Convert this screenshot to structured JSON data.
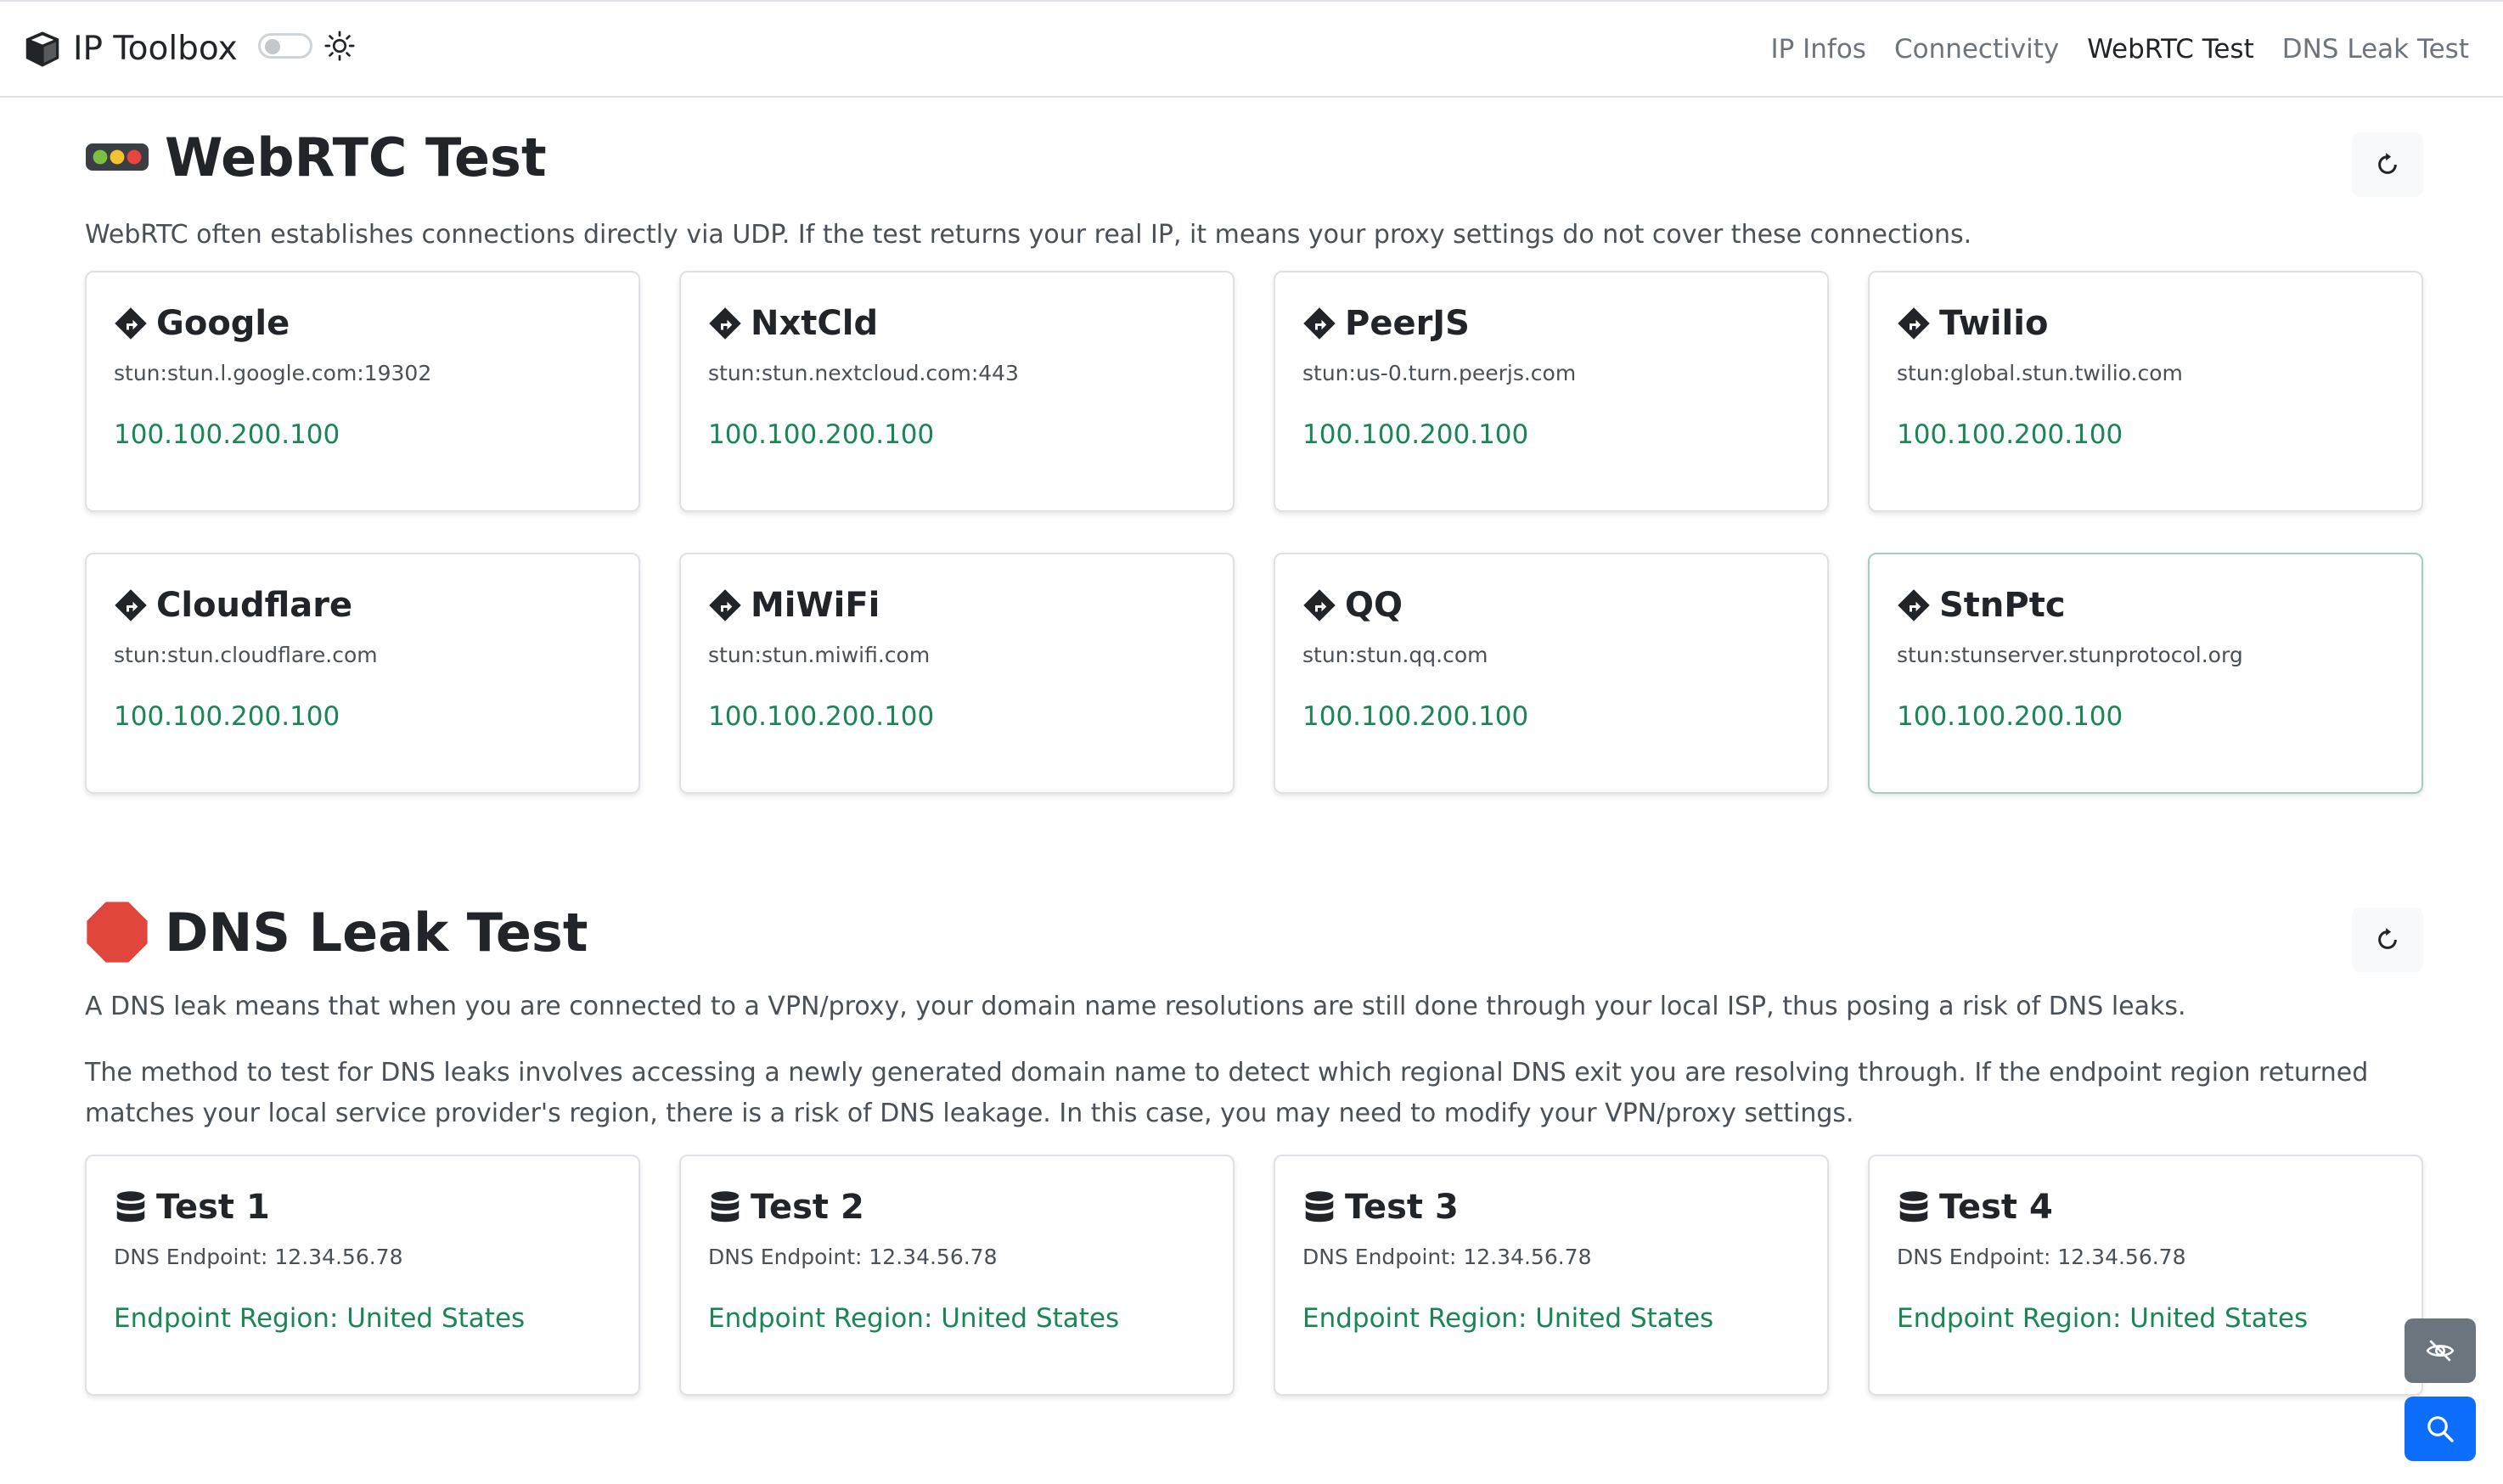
{
  "app": {
    "title": "IP Toolbox",
    "nav": [
      "IP Infos",
      "Connectivity",
      "WebRTC Test",
      "DNS Leak Test"
    ],
    "active_nav": "WebRTC Test"
  },
  "webrtc": {
    "title": "WebRTC Test",
    "description": "WebRTC often establishes connections directly via UDP. If the test returns your real IP, it means your proxy settings do not cover these connections.",
    "servers": [
      {
        "name": "Google",
        "url": "stun:stun.l.google.com:19302",
        "ip": "100.100.200.100"
      },
      {
        "name": "NxtCld",
        "url": "stun:stun.nextcloud.com:443",
        "ip": "100.100.200.100"
      },
      {
        "name": "PeerJS",
        "url": "stun:us-0.turn.peerjs.com",
        "ip": "100.100.200.100"
      },
      {
        "name": "Twilio",
        "url": "stun:global.stun.twilio.com",
        "ip": "100.100.200.100"
      },
      {
        "name": "Cloudflare",
        "url": "stun:stun.cloudflare.com",
        "ip": "100.100.200.100"
      },
      {
        "name": "MiWiFi",
        "url": "stun:stun.miwifi.com",
        "ip": "100.100.200.100"
      },
      {
        "name": "QQ",
        "url": "stun:stun.qq.com",
        "ip": "100.100.200.100"
      },
      {
        "name": "StnPtc",
        "url": "stun:stunserver.stunprotocol.org",
        "ip": "100.100.200.100"
      }
    ]
  },
  "dns": {
    "title": "DNS Leak Test",
    "description1": "A DNS leak means that when you are connected to a VPN/proxy, your domain name resolutions are still done through your local ISP, thus posing a risk of DNS leaks.",
    "description2": "The method to test for DNS leaks involves accessing a newly generated domain name to detect which regional DNS exit you are resolving through. If the endpoint region returned matches your local service provider's region, there is a risk of DNS leakage. In this case, you may need to modify your VPN/proxy settings.",
    "tests": [
      {
        "name": "Test 1",
        "endpoint": "DNS Endpoint: 12.34.56.78",
        "region": "Endpoint Region: United States"
      },
      {
        "name": "Test 2",
        "endpoint": "DNS Endpoint: 12.34.56.78",
        "region": "Endpoint Region: United States"
      },
      {
        "name": "Test 3",
        "endpoint": "DNS Endpoint: 12.34.56.78",
        "region": "Endpoint Region: United States"
      },
      {
        "name": "Test 4",
        "endpoint": "DNS Endpoint: 12.34.56.78",
        "region": "Endpoint Region: United States"
      }
    ]
  },
  "icons": {
    "brand": "box-icon",
    "theme": "sun-icon",
    "webrtc_section": "traffic-light-icon",
    "dns_section": "stop-sign-icon",
    "server": "signpost-diamond-icon",
    "dns_test": "database-icon",
    "refresh": "refresh-icon",
    "hide": "eye-slash-icon",
    "search": "search-icon"
  },
  "colors": {
    "success": "#198754",
    "primary": "#0d6efd",
    "secondary": "#6c757d",
    "stop_red": "#dc3545"
  }
}
